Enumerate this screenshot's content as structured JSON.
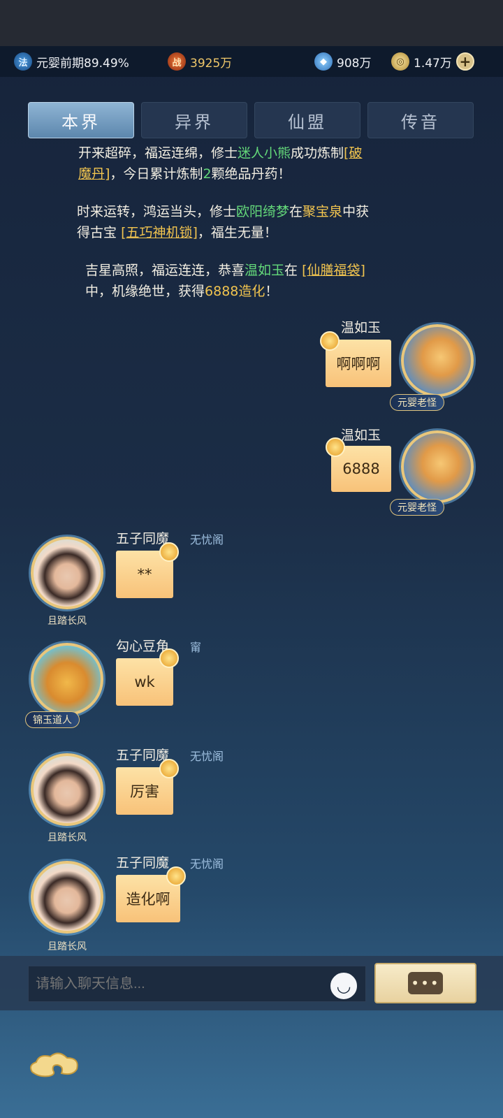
{
  "resources": {
    "realm_icon": "法",
    "realm": "元婴前期89.49%",
    "power_icon": "战",
    "power": "3925万",
    "gems": "908万",
    "coins": "1.47万",
    "plus_label": "+"
  },
  "tabs": [
    {
      "label": "本界",
      "active": true
    },
    {
      "label": "异界",
      "active": false
    },
    {
      "label": "仙盟",
      "active": false
    },
    {
      "label": "传音",
      "active": false
    }
  ],
  "system_messages": [
    {
      "line1_a": "开来超碎，福运连绵，修士",
      "line1_name": "迷人小熊",
      "line1_b": "成功炼制",
      "line1_item": "[破",
      "line2_item": "魔丹]",
      "line2_a": "，今日累计炼制",
      "line2_count": "2",
      "line2_b": "颗绝品丹药！"
    },
    {
      "a": "时来运转，鸿运当头，修士",
      "name": "欧阳绮梦",
      "b": "在",
      "place": "聚宝泉",
      "c": "中获",
      "d": "得古宝",
      "item": "[五巧神机锁]",
      "e": "，福生无量！"
    },
    {
      "a": "吉星高照，福运连连，恭喜",
      "name": "温如玉",
      "b": "在",
      "item": "[仙膳福袋]",
      "c": "中，机缘绝世，获得",
      "reward": "6888造化",
      "d": "！"
    }
  ],
  "messages": [
    {
      "name": "温如玉",
      "text": "啊啊啊",
      "title": "元婴老怪",
      "side": "right"
    },
    {
      "name": "温如玉",
      "text": "6888",
      "title": "元婴老怪",
      "side": "right"
    },
    {
      "name": "五子同魔",
      "guild": "无忧阁",
      "text": "**",
      "title": "且踏长风",
      "side": "left"
    },
    {
      "name": "勾心豆角",
      "guild": "甯",
      "text": "wk",
      "title": "锦玉道人",
      "side": "left"
    },
    {
      "name": "五子同魔",
      "guild": "无忧阁",
      "text": "厉害",
      "title": "且踏长风",
      "side": "left"
    },
    {
      "name": "五子同魔",
      "guild": "无忧阁",
      "text": "造化啊",
      "title": "且踏长风",
      "side": "left"
    }
  ],
  "input": {
    "placeholder": "请输入聊天信息...",
    "send_icon": "•••"
  },
  "colors": {
    "highlight_green": "#64d97a",
    "highlight_gold": "#f1c44f",
    "bubble": "#f8c279"
  }
}
